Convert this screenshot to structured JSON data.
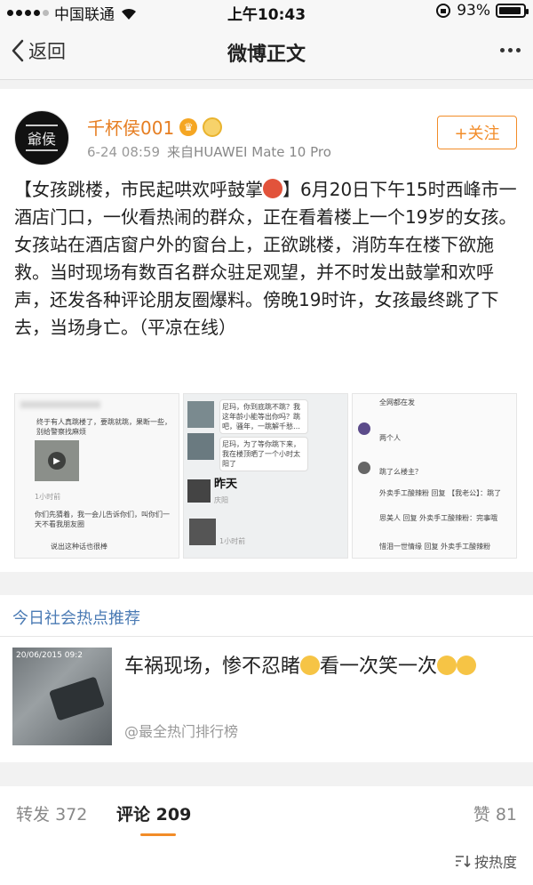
{
  "status_bar": {
    "carrier": "中国联通",
    "time": "上午10:43",
    "battery": "93%",
    "battery_level": 0.93
  },
  "nav": {
    "back_label": "返回",
    "title": "微博正文"
  },
  "post": {
    "avatar_text": "爺侯",
    "username": "千杯侯001",
    "date": "6-24 08:59",
    "source": "来自HUAWEI Mate 10 Pro",
    "follow_label": "+关注",
    "text_part1": "【女孩跳楼，市民起哄欢呼鼓掌",
    "text_part2": "】6月20日下午15时西峰市一酒店门口，一伙看热闹的群众，正在看着楼上一个19岁的女孩。女孩站在酒店窗户外的窗台上，正欲跳楼，消防车在楼下欲施救。当时现场有数百名群众驻足观望，并不时发出鼓掌和欢呼声，还发各种评论朋友圈爆料。傍晚19时许，女孩最终跳了下去，当场身亡。（平凉在线）",
    "thumbs": {
      "t1_line1": "终于有人真跳楼了，要跳就跳，果断一些，别给警察找麻烦",
      "t1_time": "1小时前",
      "t1_reply1": "你们先猜着，我一会儿告诉你们，叫你们一天不看我朋友圈",
      "t1_reply2": "说出这种话也很棒",
      "t2_chat1": "尼玛，你到底跳不跳？我这年龄小能等出你吗？跳吧，骚年，一跳解千愁…",
      "t2_chat2": "尼玛，为了等你跳下来，我在楼顶晒了一个小时太阳了",
      "t2_label": "昨天",
      "t2_sub": "庆阳",
      "t2_time": "1小时前",
      "t3_top": "全网都在发",
      "t3_two": "两个人",
      "t3_q": "跳了么楼主？",
      "t3_r1": "外卖手工酸辣粉 回复 【我老公】：跳了",
      "t3_r2": "思美人 回复 外卖手工酸辣粉：完事哦",
      "t3_r3": "惜泪一世情缘 回复 外卖手工酸辣粉"
    }
  },
  "hot": {
    "title": "今日社会热点推荐",
    "headline_part1": "车祸现场，惨不忍睹",
    "headline_part2": "看一次笑一次",
    "source": "@最全热门排行榜",
    "thumb_stamp": "20/06/2015 09:2"
  },
  "tabs": {
    "forward_label": "转发",
    "forward_count": "372",
    "comment_label": "评论",
    "comment_count": "209",
    "like_label": "赞",
    "like_count": "81",
    "sort_label": "按热度"
  }
}
